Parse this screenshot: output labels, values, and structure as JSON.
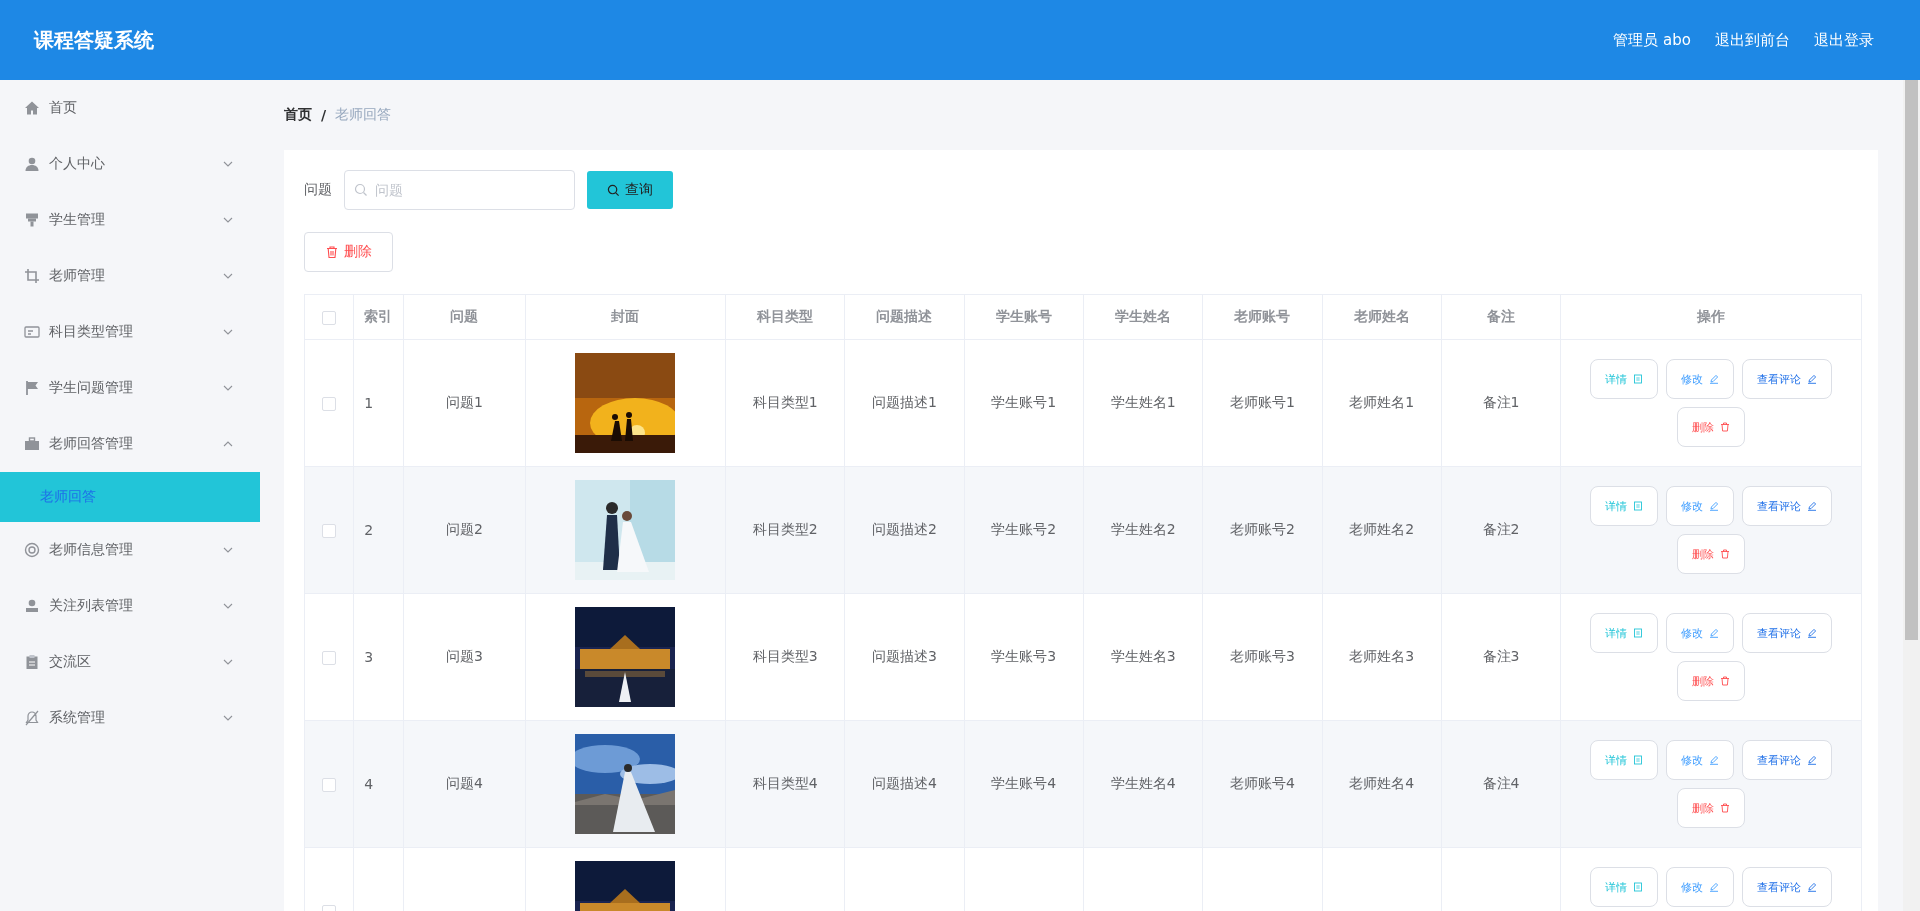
{
  "header": {
    "title": "课程答疑系统",
    "links": [
      "管理员 abo",
      "退出到前台",
      "退出登录"
    ]
  },
  "sidebar": {
    "items": [
      {
        "label": "首页",
        "kind": "link"
      },
      {
        "label": "个人中心",
        "kind": "group",
        "expanded": false
      },
      {
        "label": "学生管理",
        "kind": "group",
        "expanded": false
      },
      {
        "label": "老师管理",
        "kind": "group",
        "expanded": false
      },
      {
        "label": "科目类型管理",
        "kind": "group",
        "expanded": false
      },
      {
        "label": "学生问题管理",
        "kind": "group",
        "expanded": false
      },
      {
        "label": "老师回答管理",
        "kind": "group",
        "expanded": true,
        "children": [
          {
            "label": "老师回答",
            "selected": true
          }
        ]
      },
      {
        "label": "老师信息管理",
        "kind": "group",
        "expanded": false
      },
      {
        "label": "关注列表管理",
        "kind": "group",
        "expanded": false
      },
      {
        "label": "交流区",
        "kind": "group",
        "expanded": false
      },
      {
        "label": "系统管理",
        "kind": "group",
        "expanded": false
      }
    ]
  },
  "breadcrumb": {
    "items": [
      "首页",
      "老师回答"
    ],
    "separator": "/"
  },
  "search": {
    "label": "问题",
    "placeholder": "问题",
    "button": "查询"
  },
  "delete_button": "删除",
  "table": {
    "select_all": {
      "checked": false
    },
    "columns": [
      "索引",
      "问题",
      "封面",
      "科目类型",
      "问题描述",
      "学生账号",
      "学生姓名",
      "老师账号",
      "老师姓名",
      "备注",
      "操作"
    ],
    "rows": [
      {
        "checked": false,
        "cells": [
          "1",
          "问题1",
          {
            "kind": "picture"
          },
          "科目类型1",
          "问题描述1",
          "学生账号1",
          "学生姓名1",
          "老师账号1",
          "老师姓名1",
          "备注1",
          {
            "actions": [
              {
                "label": "详情",
                "kind": "detail"
              },
              {
                "label": "修改",
                "kind": "edit"
              },
              {
                "label": "查看评论",
                "kind": "comment"
              },
              {
                "label": "删除",
                "kind": "delete"
              }
            ]
          }
        ]
      },
      {
        "checked": false,
        "cells": [
          "2",
          "问题2",
          {
            "kind": "picture"
          },
          "科目类型2",
          "问题描述2",
          "学生账号2",
          "学生姓名2",
          "老师账号2",
          "老师姓名2",
          "备注2",
          {
            "actions": [
              {
                "label": "详情",
                "kind": "detail"
              },
              {
                "label": "修改",
                "kind": "edit"
              },
              {
                "label": "查看评论",
                "kind": "comment"
              },
              {
                "label": "删除",
                "kind": "delete"
              }
            ]
          }
        ]
      },
      {
        "checked": false,
        "cells": [
          "3",
          "问题3",
          {
            "kind": "picture"
          },
          "科目类型3",
          "问题描述3",
          "学生账号3",
          "学生姓名3",
          "老师账号3",
          "老师姓名3",
          "备注3",
          {
            "actions": [
              {
                "label": "详情",
                "kind": "detail"
              },
              {
                "label": "修改",
                "kind": "edit"
              },
              {
                "label": "查看评论",
                "kind": "comment"
              },
              {
                "label": "删除",
                "kind": "delete"
              }
            ]
          }
        ]
      },
      {
        "checked": false,
        "cells": [
          "4",
          "问题4",
          {
            "kind": "picture"
          },
          "科目类型4",
          "问题描述4",
          "学生账号4",
          "学生姓名4",
          "老师账号4",
          "老师姓名4",
          "备注4",
          {
            "actions": [
              {
                "label": "详情",
                "kind": "detail"
              },
              {
                "label": "修改",
                "kind": "edit"
              },
              {
                "label": "查看评论",
                "kind": "comment"
              },
              {
                "label": "删除",
                "kind": "delete"
              }
            ]
          }
        ]
      },
      {
        "checked": false,
        "cells": [
          null,
          null,
          {
            "kind": "picture"
          },
          null,
          null,
          null,
          null,
          null,
          null,
          null,
          {
            "actions": [
              {
                "label": "详情",
                "kind": "detail"
              },
              {
                "label": "修改",
                "kind": "edit"
              },
              {
                "label": "查看评论",
                "kind": "comment"
              }
            ]
          }
        ]
      }
    ]
  }
}
